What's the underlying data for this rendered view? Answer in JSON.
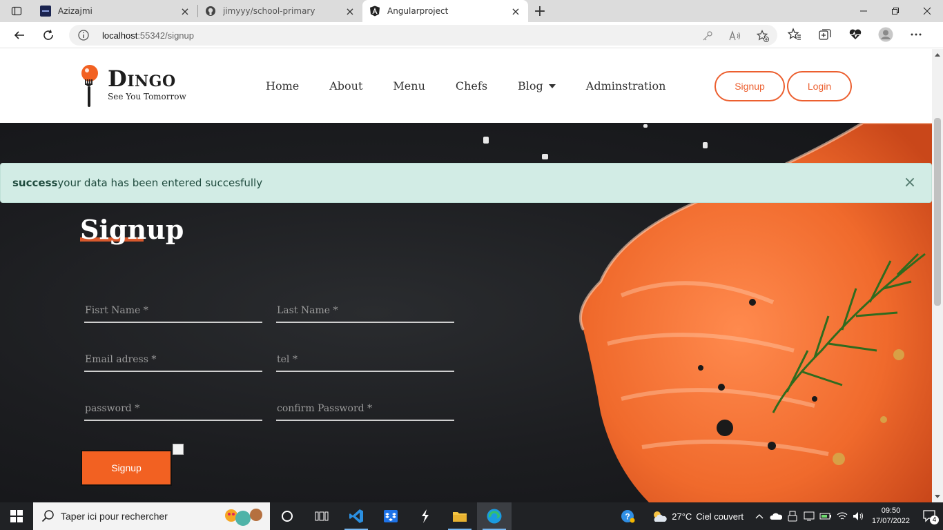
{
  "browser": {
    "tabs": [
      {
        "title": "Azizajmi",
        "active": false
      },
      {
        "title": "jimyyy/school-primary",
        "active": false
      },
      {
        "title": "Angularproject",
        "active": true
      }
    ],
    "url_host": "localhost",
    "url_path": ":55342/signup"
  },
  "site": {
    "logo_name": "Dingo",
    "logo_tagline": "See You Tomorrow",
    "nav": [
      "Home",
      "About",
      "Menu",
      "Chefs",
      "Blog",
      "Adminstration"
    ],
    "signup_label": "Signup",
    "login_label": "Login"
  },
  "alert": {
    "strong": "success",
    "message": "your data has been entered succesfully"
  },
  "form": {
    "title": "Signup",
    "first_name_ph": "Fisrt Name *",
    "last_name_ph": "Last Name *",
    "email_ph": "Email adress *",
    "tel_ph": "tel *",
    "password_ph": "password *",
    "confirm_ph": "confirm Password *",
    "submit_label": "Signup"
  },
  "taskbar": {
    "search_placeholder": "Taper ici pour rechercher",
    "weather_temp": "27°C",
    "weather_desc": "Ciel couvert",
    "time": "09:50",
    "date": "17/07/2022",
    "notif_count": "4"
  },
  "colors": {
    "accent": "#ec5f2f",
    "alert_bg": "#d2ece5",
    "taskbar_bg": "#202225"
  }
}
